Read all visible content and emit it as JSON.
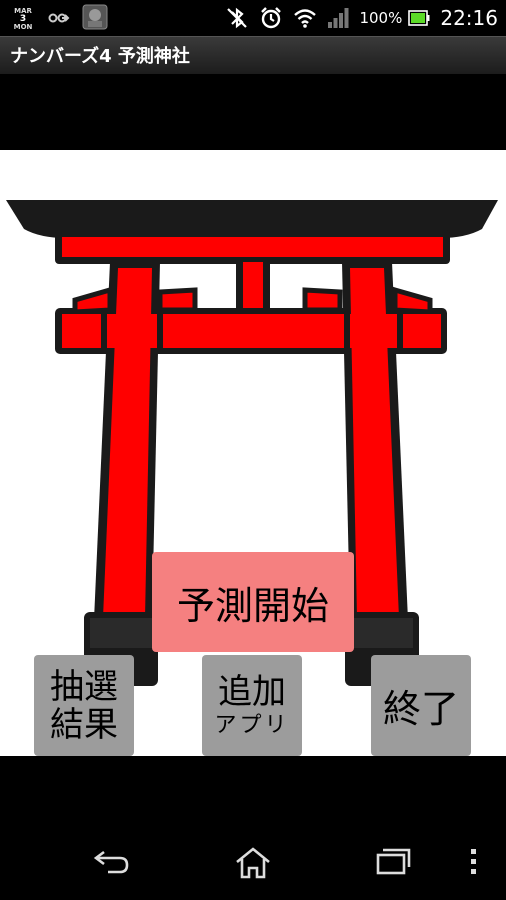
{
  "status_bar": {
    "calendar_month": "MAR",
    "calendar_day": "3",
    "calendar_weekday": "MON",
    "battery_percent": "100%",
    "clock": "22:16",
    "icons": [
      "calendar-icon",
      "voicemail-icon",
      "app-notification-icon",
      "bluetooth-off-icon",
      "alarm-icon",
      "wifi-icon",
      "signal-icon",
      "battery-icon"
    ]
  },
  "app": {
    "title": "ナンバーズ4 予測神社"
  },
  "buttons": {
    "start_prediction": "予測開始",
    "results_line1": "抽選",
    "results_line2": "結果",
    "more_apps_line1": "追加",
    "more_apps_line2": "アプリ",
    "exit": "終了"
  },
  "colors": {
    "torii_red": "#ff0000",
    "torii_black": "#1a1a1a",
    "start_button": "#f58080",
    "gray_button": "#9c9c9c"
  },
  "nav_bar": {
    "icons": [
      "back-icon",
      "home-icon",
      "recent-apps-icon",
      "menu-icon"
    ]
  }
}
